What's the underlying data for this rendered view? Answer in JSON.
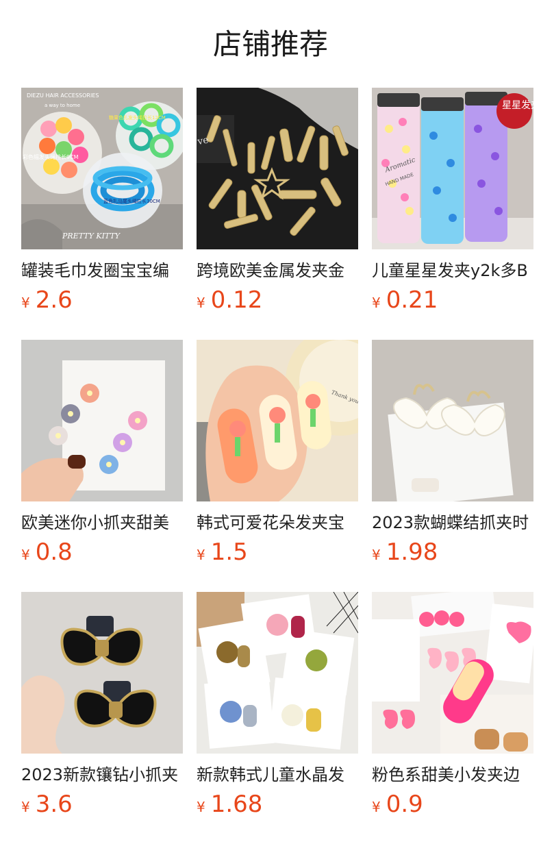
{
  "header": {
    "title": "店铺推荐"
  },
  "currency_symbol": "¥",
  "products": [
    {
      "name": "罐装毛巾发圈宝宝编",
      "price": "2.6",
      "image_icon": "hair-ties-jar-image"
    },
    {
      "name": "跨境欧美金属发夹金",
      "price": "0.12",
      "image_icon": "gold-hair-clips-image"
    },
    {
      "name": "儿童星星发夹y2k多B",
      "price": "0.21",
      "image_icon": "star-clips-tubes-image"
    },
    {
      "name": "欧美迷你小抓夹甜美",
      "price": "0.8",
      "image_icon": "flower-claw-clips-image"
    },
    {
      "name": "韩式可爱花朵发夹宝",
      "price": "1.5",
      "image_icon": "tulip-hair-clips-image"
    },
    {
      "name": "2023款蝴蝶结抓夹时",
      "price": "1.98",
      "image_icon": "bow-claw-clips-image"
    },
    {
      "name": "2023新款镶钻小抓夹",
      "price": "3.6",
      "image_icon": "velvet-bow-clips-image"
    },
    {
      "name": "新款韩式儿童水晶发",
      "price": "1.68",
      "image_icon": "crystal-flower-clips-image"
    },
    {
      "name": "粉色系甜美小发夹边",
      "price": "0.9",
      "image_icon": "pink-sweet-clips-image"
    }
  ],
  "image_texts": {
    "p0_top": "DIEZU HAIR ACCESSORIES",
    "p0_sub": "a way to home",
    "p0_label1": "彩色幅发头绳拉长9CM",
    "p0_label2": "蓝色扎马尾头绳拉长30CM",
    "p0_label3": "糖果色扎发头绳拉长12CM",
    "p0_bottom": "PRETTY KITTY",
    "p2_badge": "星星发夹",
    "p2_brand": "Aromatic",
    "p2_hand": "HAND MADE",
    "p4_card": "Thank you please ur"
  },
  "colors": {
    "price": "#e8461a",
    "title": "#1a1a1a",
    "text": "#222222"
  }
}
